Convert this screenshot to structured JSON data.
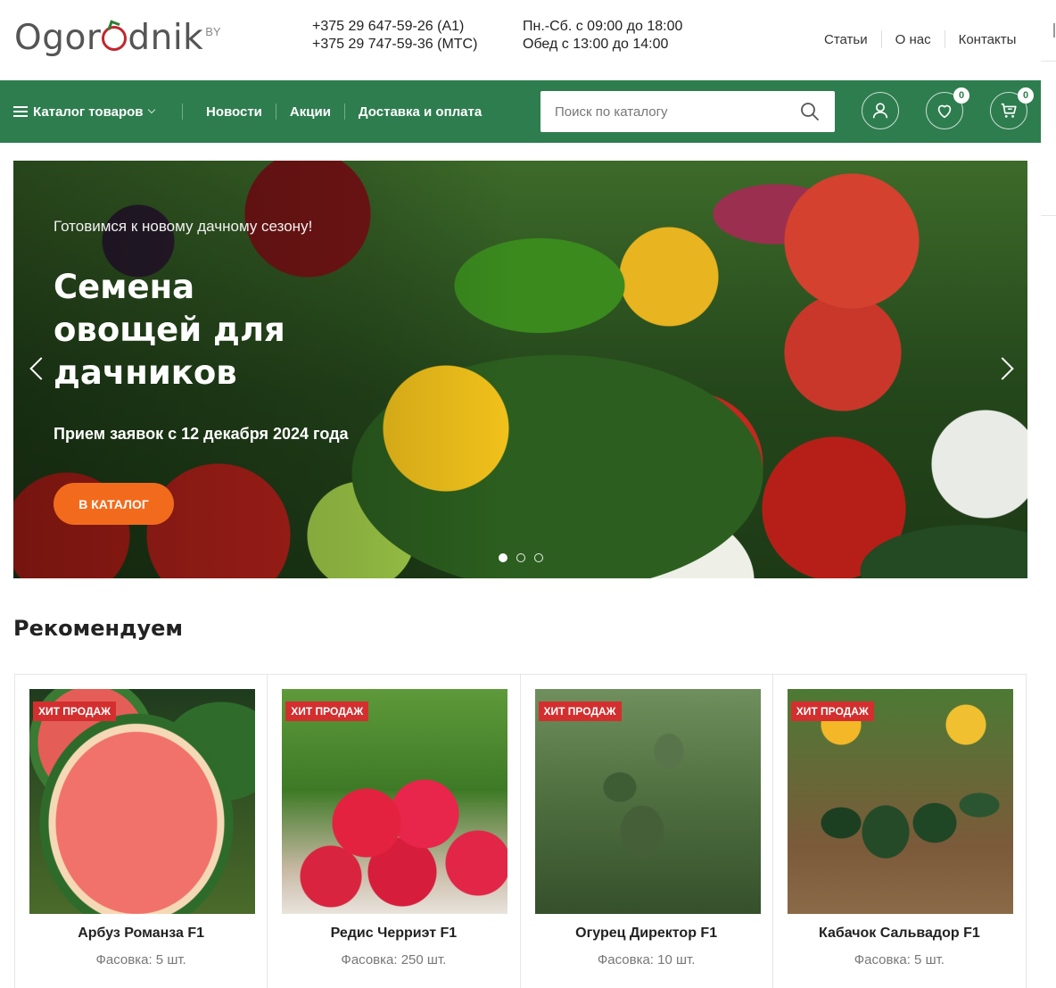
{
  "header": {
    "logo_text_1": "Ogor",
    "logo_text_2": "dnik",
    "logo_sup": "BY",
    "phones": [
      "+375 29 647-59-26 (А1)",
      "+375 29 747-59-36 (МТС)"
    ],
    "hours": [
      "Пн.-Сб. с 09:00 до 18:00",
      "Обед с 13:00 до 14:00"
    ],
    "links": [
      "Статьи",
      "О нас",
      "Контакты"
    ]
  },
  "nav": {
    "catalog_label": "Каталог товаров",
    "links": [
      "Новости",
      "Акции",
      "Доставка и оплата"
    ],
    "search_placeholder": "Поиск по каталогу",
    "wishlist_count": "0",
    "cart_count": "0"
  },
  "hero": {
    "kicker": "Готовимся к новому дачному сезону!",
    "title": "Семена овощей для дачников",
    "subtitle": "Прием заявок с 12 декабря 2024 года",
    "button": "В КАТАЛОГ",
    "active_slide": 1,
    "slide_count": 3
  },
  "recommended": {
    "title": "Рекомендуем",
    "products": [
      {
        "badge": "ХИТ ПРОДАЖ",
        "name": "Арбуз Романза F1",
        "meta": "Фасовка: 5 шт."
      },
      {
        "badge": "ХИТ ПРОДАЖ",
        "name": "Редис Черриэт F1",
        "meta": "Фасовка: 250 шт."
      },
      {
        "badge": "ХИТ ПРОДАЖ",
        "name": "Огурец Директор F1",
        "meta": "Фасовка: 10 шт."
      },
      {
        "badge": "ХИТ ПРОДАЖ",
        "name": "Кабачок Сальвадор F1",
        "meta": "Фасовка: 5 шт."
      }
    ]
  },
  "colors": {
    "brand_green": "#2e7d4f",
    "accent_orange": "#f26b1d",
    "badge_red": "#d32f2f"
  },
  "icons": [
    "menu-icon",
    "chevron-down-icon",
    "search-icon",
    "user-icon",
    "heart-icon",
    "cart-icon",
    "arrow-left-icon",
    "arrow-right-icon"
  ]
}
